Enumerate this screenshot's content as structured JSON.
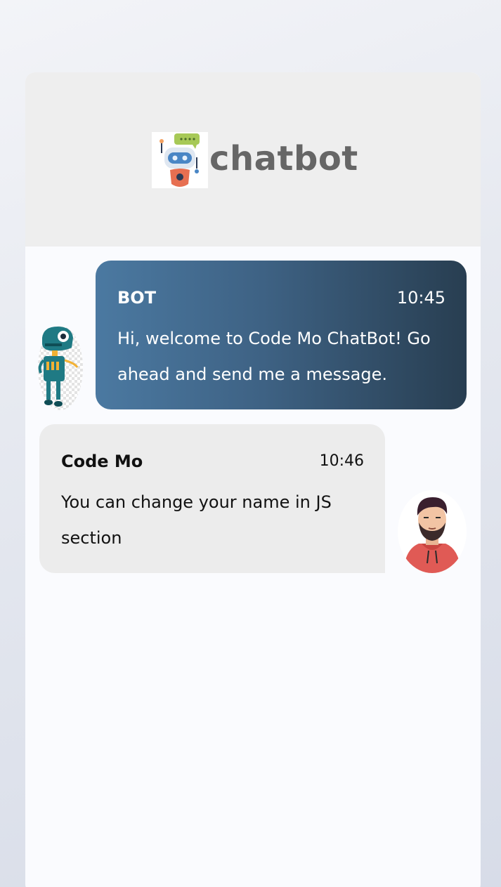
{
  "header": {
    "brand": "chatbot",
    "logo_icon": "robot-chat-icon"
  },
  "messages": [
    {
      "sender": "BOT",
      "time": "10:45",
      "text": "Hi, welcome to Code Mo ChatBot! Go ahead and send me a message.",
      "avatar_icon": "robot-avatar-icon"
    },
    {
      "sender": "Code Mo",
      "time": "10:46",
      "text": "You can change your name in JS section",
      "avatar_icon": "user-avatar-icon"
    }
  ],
  "colors": {
    "bot_bubble_start": "#4b79a1",
    "bot_bubble_end": "#283e51",
    "user_bubble": "#ececec",
    "header_bg": "#eeeeee",
    "brand_text": "#666666"
  }
}
